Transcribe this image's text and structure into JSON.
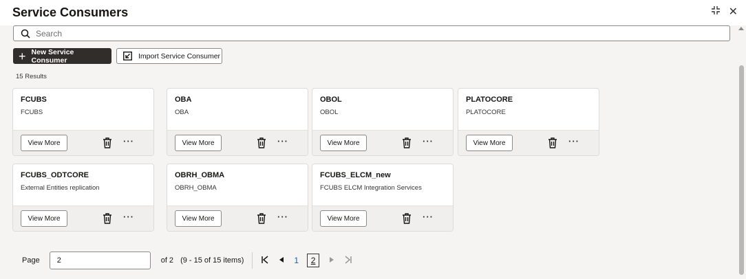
{
  "header": {
    "title": "Service Consumers",
    "resize_icon": "collapse-arrows-icon",
    "close_icon": "close-icon",
    "close_glyph": "✕",
    "resize_glyph": "⤡"
  },
  "search": {
    "placeholder": "Search"
  },
  "toolbar": {
    "new_label": "New Service Consumer",
    "import_label": "Import Service Consumer"
  },
  "results_label": "15 Results",
  "cards": [
    {
      "title": "FCUBS",
      "subtitle": "FCUBS"
    },
    {
      "title": "OBA",
      "subtitle": "OBA"
    },
    {
      "title": "OBOL",
      "subtitle": "OBOL"
    },
    {
      "title": "PLATOCORE",
      "subtitle": "PLATOCORE"
    },
    {
      "title": "FCUBS_ODTCORE",
      "subtitle": "External Entities replication"
    },
    {
      "title": "OBRH_OBMA",
      "subtitle": "OBRH_OBMA"
    },
    {
      "title": "FCUBS_ELCM_new",
      "subtitle": "FCUBS ELCM Integration Services"
    }
  ],
  "card_actions": {
    "view_more": "View More",
    "more_glyph": "···"
  },
  "pagination": {
    "page_label": "Page",
    "page_value": "2",
    "of_text": "of 2",
    "range_text": "(9 - 15 of 15 items)",
    "first_glyph": "|<",
    "prev_glyph": "◂",
    "next_glyph": "▸",
    "last_glyph": ">|",
    "pages": [
      "1",
      "2"
    ],
    "current_page": "2"
  }
}
